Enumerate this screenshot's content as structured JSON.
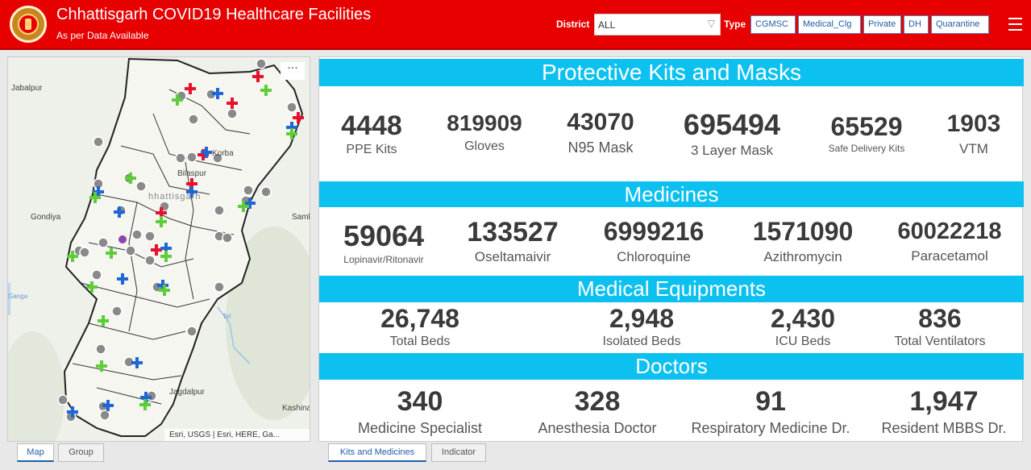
{
  "header": {
    "title": "Chhattisgarh COVID19 Healthcare Facilities",
    "subtitle": "As per Data Available",
    "district_label": "District",
    "district_value": "ALL",
    "type_label": "Type",
    "type_buttons": [
      "CGMSC",
      "Medical_Clg",
      "Private",
      "DH",
      "Quarantine"
    ],
    "menu_icon": "hamburger-icon"
  },
  "map": {
    "labels": [
      "Jabalpur",
      "Gondiya",
      "Bilaspur",
      "hhattisgarh",
      "Korba",
      "Sambalpur",
      "Jagdalpur",
      "Kashina",
      "Tel",
      "Ganga"
    ],
    "more_button": "···",
    "attribution": "Esri, USGS | Esri, HERE, Ga...",
    "tabs": [
      "Map",
      "Group"
    ]
  },
  "dashboard": {
    "sections": {
      "kits": "Protective Kits and Masks",
      "medicines": "Medicines",
      "equipments": "Medical Equipments",
      "doctors": "Doctors"
    },
    "kits": [
      {
        "value": "4448",
        "label": "PPE Kits"
      },
      {
        "value": "819909",
        "label": "Gloves"
      },
      {
        "value": "43070",
        "label": "N95 Mask"
      },
      {
        "value": "695494",
        "label": "3 Layer Mask"
      },
      {
        "value": "65529",
        "label": "Safe Delivery Kits"
      },
      {
        "value": "1903",
        "label": "VTM"
      }
    ],
    "medicines": [
      {
        "value": "59064",
        "label": "Lopinavir/Ritonavir"
      },
      {
        "value": "133527",
        "label": "Oseltamaivir"
      },
      {
        "value": "6999216",
        "label": "Chloroquine"
      },
      {
        "value": "1571090",
        "label": "Azithromycin"
      },
      {
        "value": "60022218",
        "label": "Paracetamol"
      }
    ],
    "equipments": [
      {
        "value": "26,748",
        "label": "Total Beds"
      },
      {
        "value": "2,948",
        "label": "Isolated Beds"
      },
      {
        "value": "2,430",
        "label": "ICU Beds"
      },
      {
        "value": "836",
        "label": "Total Ventilators"
      }
    ],
    "doctors": [
      {
        "value": "340",
        "label": "Medicine Specialist"
      },
      {
        "value": "328",
        "label": "Anesthesia Doctor"
      },
      {
        "value": "91",
        "label": "Respiratory Medicine Dr."
      },
      {
        "value": "1,947",
        "label": "Resident MBBS Dr."
      }
    ],
    "tabs": [
      "Kits and Medicines",
      "Indicator"
    ]
  },
  "colors": {
    "header_bg": "#e60000",
    "band_bg": "#0cc0ef",
    "marker_gray": "#8a8a8a",
    "marker_red": "#e8112d",
    "marker_blue": "#1f66d6",
    "marker_green": "#5fcc3a"
  }
}
